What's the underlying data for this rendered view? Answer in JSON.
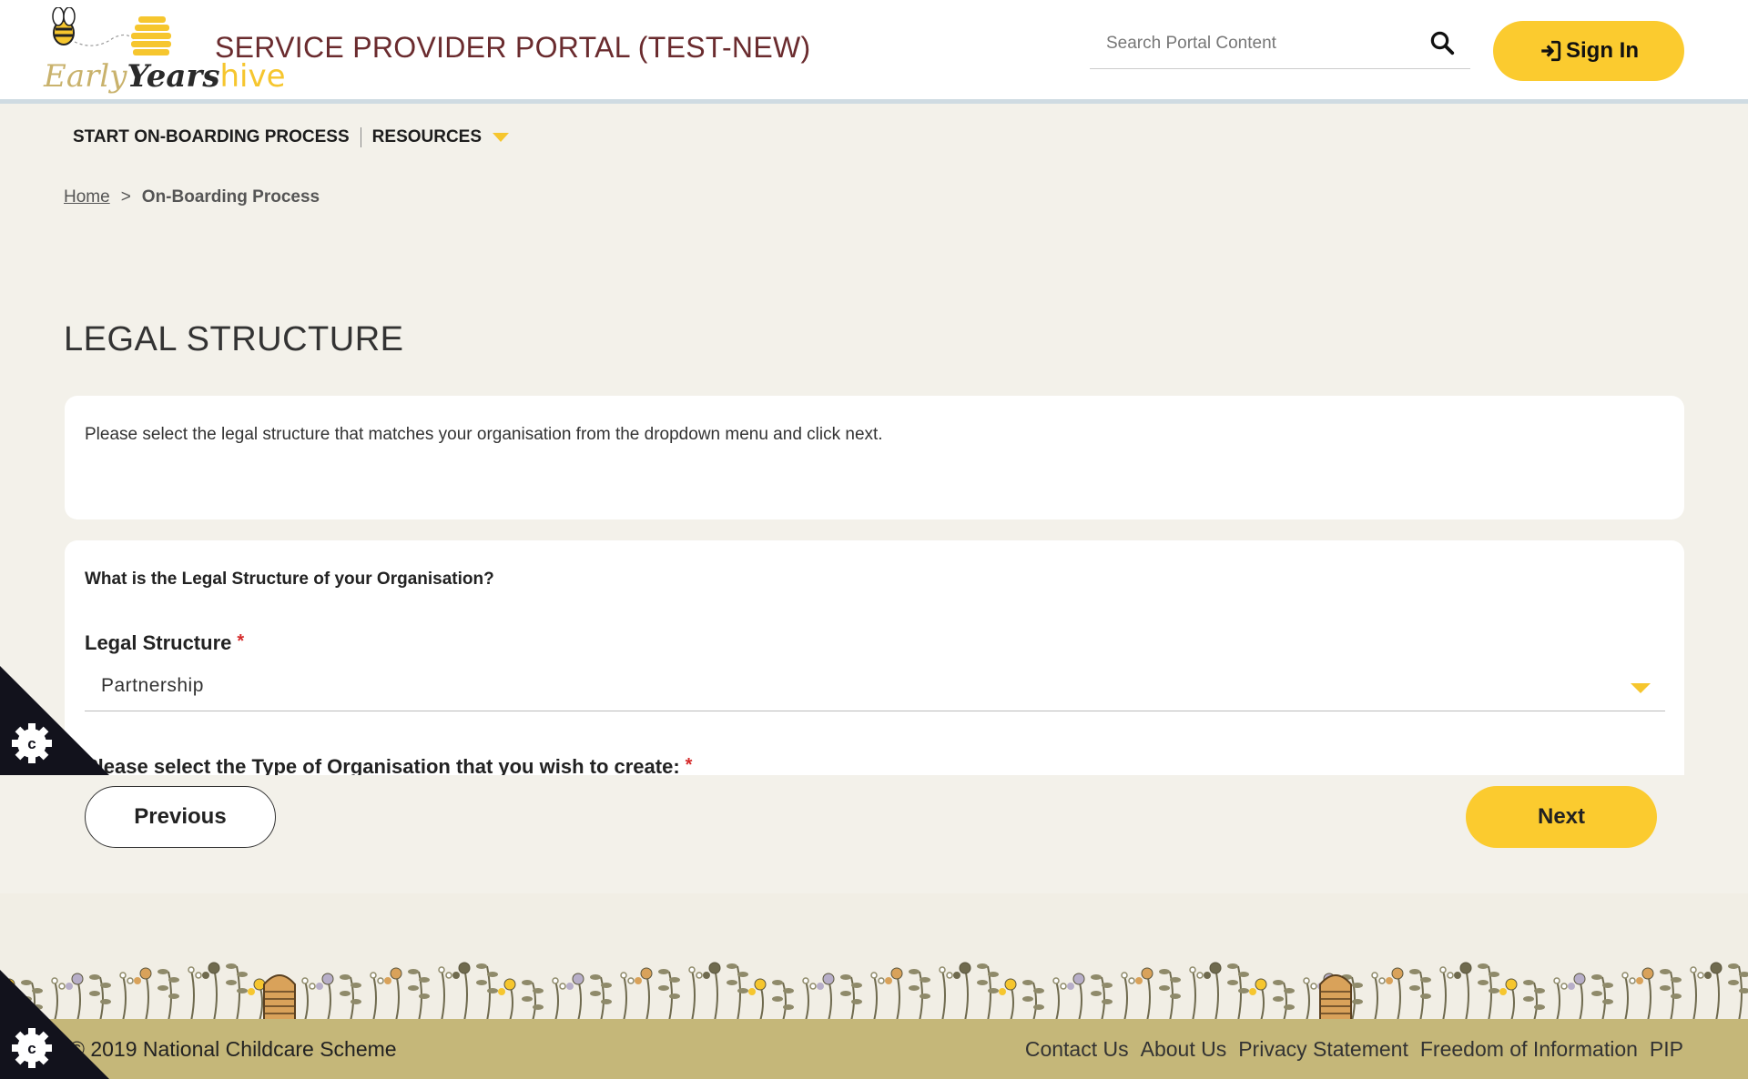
{
  "header": {
    "logo": {
      "early": "Early",
      "years": "Years",
      "hive": "hive"
    },
    "portal_title": "SERVICE PROVIDER PORTAL (TEST-NEW)",
    "search_placeholder": "Search Portal Content",
    "signin_label": "Sign In"
  },
  "nav": {
    "items": [
      {
        "label": "START ON-BOARDING PROCESS"
      },
      {
        "label": "RESOURCES"
      }
    ]
  },
  "breadcrumb": {
    "home": "Home",
    "separator": ">",
    "current": "On-Boarding Process"
  },
  "page": {
    "heading": "LEGAL STRUCTURE",
    "intro": "Please select the legal structure that matches your organisation from the dropdown menu and click next.",
    "question": "What is the Legal Structure of your Organisation?",
    "field_label": "Legal Structure",
    "required_mark": "*",
    "selected_value": "Partnership",
    "question2": "Please select the Type of Organisation that you wish to create:"
  },
  "buttons": {
    "previous": "Previous",
    "next": "Next"
  },
  "footer": {
    "copyright": "© 2019 National Childcare Scheme",
    "links": [
      "Contact Us",
      "About Us",
      "Privacy Statement",
      "Freedom of Information",
      "PIP"
    ]
  },
  "colors": {
    "accent": "#fbcb2f",
    "title": "#6a2b2e",
    "footer": "#c5b779",
    "required": "#d52b2b"
  },
  "icons": [
    "bee-logo-icon",
    "search-icon",
    "sign-in-icon",
    "chevron-down-icon",
    "cookie-settings-icon"
  ]
}
